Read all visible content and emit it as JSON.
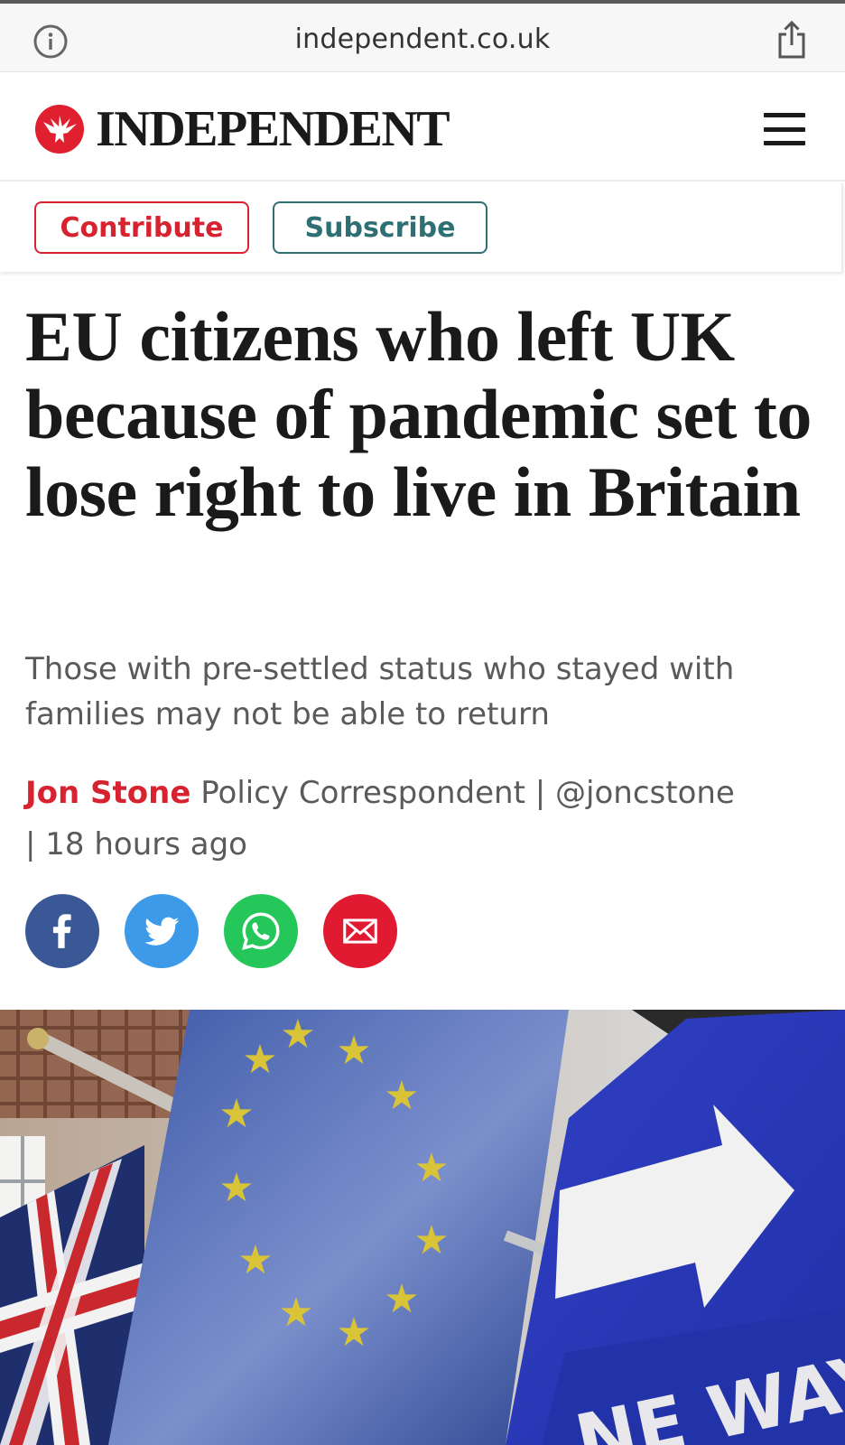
{
  "browser": {
    "url": "independent.co.uk",
    "info_icon": "info-circle-icon",
    "share_icon": "share-icon"
  },
  "masthead": {
    "logo_text": "INDEPENDENT",
    "logo_icon": "eagle-logo-icon",
    "menu_icon": "hamburger-menu-icon"
  },
  "actions": {
    "contribute_label": "Contribute",
    "subscribe_label": "Subscribe"
  },
  "article": {
    "headline": "EU citizens who left UK because of pandemic set to lose right to live in Britain",
    "standfirst": "Those with pre-settled status who stayed with families may not be able to return",
    "author": "Jon Stone",
    "role": "Policy Correspondent",
    "twitter": "@joncstone",
    "time": "18 hours ago"
  },
  "share": [
    {
      "icon": "facebook-icon",
      "color": "#3a5896"
    },
    {
      "icon": "twitter-icon",
      "color": "#3d9ae8"
    },
    {
      "icon": "whatsapp-icon",
      "color": "#25c75a"
    },
    {
      "icon": "email-icon",
      "color": "#e01a31"
    }
  ],
  "colors": {
    "brand_red": "#d6232f",
    "subscribe_teal": "#2e6f73",
    "text_dark": "#1a1a1a",
    "text_grey": "#5a5a5a"
  }
}
